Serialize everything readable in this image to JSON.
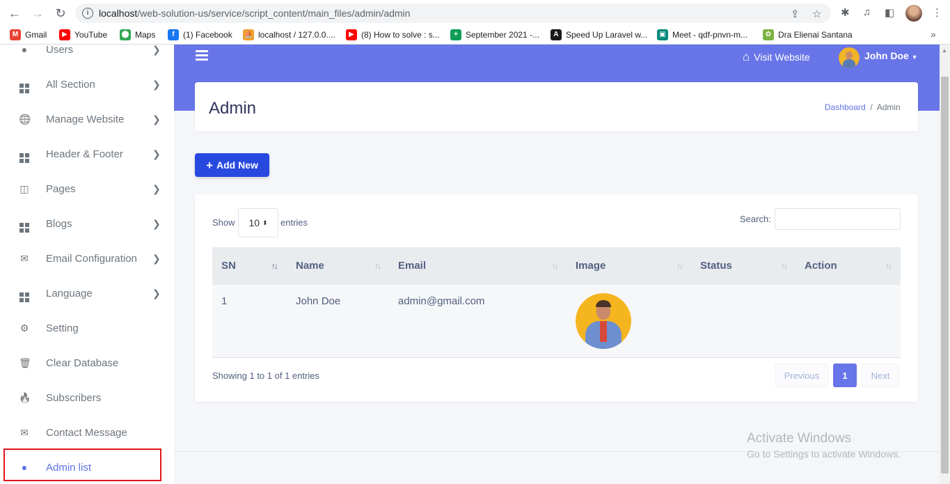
{
  "browser": {
    "url_host": "localhost",
    "url_path": "/web-solution-us/service/script_content/main_files/admin/admin",
    "bookmarks": [
      {
        "label": "Gmail",
        "icon": "gmail-icon",
        "color": "#ea4335",
        "glyph": "M"
      },
      {
        "label": "YouTube",
        "icon": "youtube-icon",
        "color": "#ff0000",
        "glyph": "▶"
      },
      {
        "label": "Maps",
        "icon": "maps-icon",
        "color": "#34a853",
        "glyph": "⬤"
      },
      {
        "label": "(1) Facebook",
        "icon": "facebook-icon",
        "color": "#1877f2",
        "glyph": "f"
      },
      {
        "label": "localhost / 127.0.0....",
        "icon": "phpmyadmin-icon",
        "color": "#f0a030",
        "glyph": "⛵"
      },
      {
        "label": "(8) How to solve : s...",
        "icon": "youtube-icon",
        "color": "#ff0000",
        "glyph": "▶"
      },
      {
        "label": "September 2021 -...",
        "icon": "sheets-icon",
        "color": "#0f9d58",
        "glyph": "+"
      },
      {
        "label": "Speed Up Laravel w...",
        "icon": "laravel-icon",
        "color": "#1a1a1a",
        "glyph": "A"
      },
      {
        "label": "Meet - qdf-pnvn-m...",
        "icon": "meet-icon",
        "color": "#00897b",
        "glyph": "▣"
      },
      {
        "label": "Dra Elienai Santana",
        "icon": "site-icon",
        "color": "#7cb342",
        "glyph": "✿"
      }
    ]
  },
  "sidebar": {
    "items": [
      {
        "label": "Users",
        "icon": "users-icon",
        "has_arrow": true
      },
      {
        "label": "All Section",
        "icon": "grid-icon",
        "has_arrow": true
      },
      {
        "label": "Manage Website",
        "icon": "globe-icon",
        "has_arrow": true
      },
      {
        "label": "Header & Footer",
        "icon": "grid-icon",
        "has_arrow": true
      },
      {
        "label": "Pages",
        "icon": "columns-icon",
        "has_arrow": true
      },
      {
        "label": "Blogs",
        "icon": "grid-icon",
        "has_arrow": true
      },
      {
        "label": "Email Configuration",
        "icon": "envelope-icon",
        "has_arrow": true
      },
      {
        "label": "Language",
        "icon": "grid-icon",
        "has_arrow": true
      },
      {
        "label": "Setting",
        "icon": "gear-icon",
        "has_arrow": false
      },
      {
        "label": "Clear Database",
        "icon": "trash-icon",
        "has_arrow": false
      },
      {
        "label": "Subscribers",
        "icon": "fire-icon",
        "has_arrow": false
      },
      {
        "label": "Contact Message",
        "icon": "envelope-icon",
        "has_arrow": false
      },
      {
        "label": "Admin list",
        "icon": "user-icon",
        "has_arrow": false,
        "active": true
      }
    ]
  },
  "topbar": {
    "visit_website": "Visit Website",
    "user_name": "John Doe"
  },
  "header": {
    "title": "Admin",
    "breadcrumb_home": "Dashboard",
    "breadcrumb_sep": "/",
    "breadcrumb_current": "Admin"
  },
  "actions": {
    "add_new": "Add New"
  },
  "table_controls": {
    "show": "Show",
    "entries_value": "10",
    "entries": "entries",
    "search": "Search:"
  },
  "table": {
    "columns": [
      "SN",
      "Name",
      "Email",
      "Image",
      "Status",
      "Action"
    ],
    "rows": [
      {
        "sn": "1",
        "name": "John Doe",
        "email": "admin@gmail.com",
        "status": "",
        "action": ""
      }
    ]
  },
  "pagination": {
    "info": "Showing 1 to 1 of 1 entries",
    "previous": "Previous",
    "current": "1",
    "next": "Next"
  },
  "watermark": {
    "line1": "Activate Windows",
    "line2": "Go to Settings to activate Windows."
  },
  "colors": {
    "accent": "#6875e8",
    "button": "#2849e0",
    "highlight_border": "#e0161b"
  }
}
